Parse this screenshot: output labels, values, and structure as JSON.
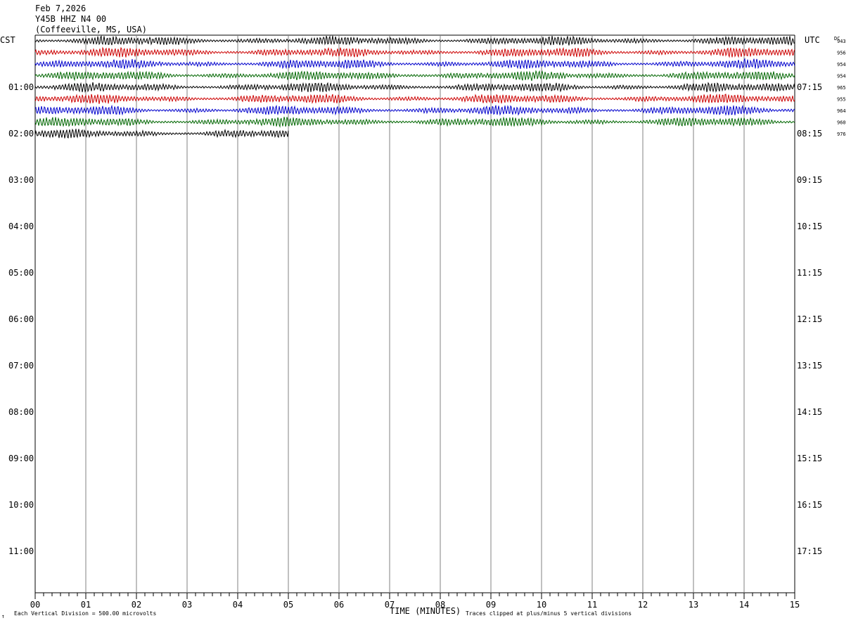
{
  "header": {
    "date": "Feb 7,2026",
    "station": "Y45B HHZ N4 00",
    "location": "(Coffeeville, MS, USA)"
  },
  "left_tz": "CST",
  "right_tz": "UTC",
  "dc_label": "DC",
  "footer": {
    "xlabel": "TIME (MINUTES)",
    "scale_note": "Each Vertical Division =  500.00 microvolts",
    "clip_note": "Traces clipped at plus/minus 5 vertical divisions",
    "corner_mark": "↑"
  },
  "colors": {
    "trace_cycle": [
      "#000000",
      "#cc0000",
      "#0000cc",
      "#006600"
    ],
    "gridline": "#808080",
    "frame": "#000000"
  },
  "chart_data": {
    "type": "line",
    "title": "",
    "xlabel": "TIME (MINUTES)",
    "ylabel": "",
    "xlim": [
      0,
      15
    ],
    "x_ticks": [
      "00",
      "01",
      "02",
      "03",
      "04",
      "05",
      "06",
      "07",
      "08",
      "09",
      "10",
      "11",
      "12",
      "13",
      "14",
      "15"
    ],
    "left_hour_labels": [
      "01:00",
      "02:00",
      "03:00",
      "04:00",
      "05:00",
      "06:00",
      "07:00",
      "08:00",
      "09:00",
      "10:00",
      "11:00"
    ],
    "right_hour_labels": [
      "07:15",
      "08:15",
      "09:15",
      "10:15",
      "11:15",
      "12:15",
      "13:15",
      "14:15",
      "15:15",
      "16:15",
      "17:15"
    ],
    "rows_per_hour": 4,
    "total_rows": 48,
    "series": [
      {
        "row": 0,
        "start_minute": 0,
        "end_minute": 15,
        "dc": "943"
      },
      {
        "row": 1,
        "start_minute": 0,
        "end_minute": 15,
        "dc": "956"
      },
      {
        "row": 2,
        "start_minute": 0,
        "end_minute": 15,
        "dc": "954"
      },
      {
        "row": 3,
        "start_minute": 0,
        "end_minute": 15,
        "dc": "954"
      },
      {
        "row": 4,
        "start_minute": 0,
        "end_minute": 15,
        "dc": "965"
      },
      {
        "row": 5,
        "start_minute": 0,
        "end_minute": 15,
        "dc": "955"
      },
      {
        "row": 6,
        "start_minute": 0,
        "end_minute": 15,
        "dc": "964"
      },
      {
        "row": 7,
        "start_minute": 0,
        "end_minute": 15,
        "dc": "960"
      },
      {
        "row": 8,
        "start_minute": 0,
        "end_minute": 5,
        "dc": "976"
      }
    ]
  }
}
